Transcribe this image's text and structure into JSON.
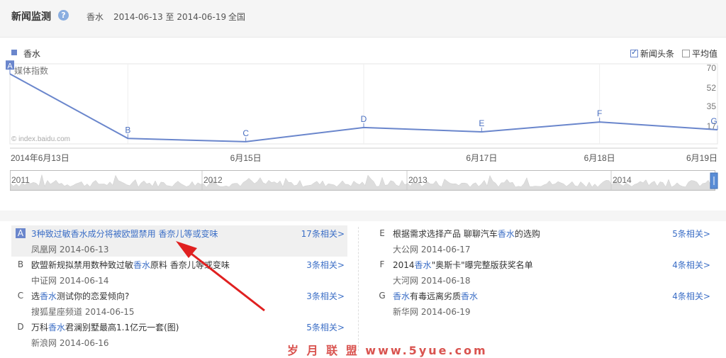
{
  "header": {
    "title": "新闻监测",
    "help_icon": "question-icon",
    "keyword": "香水",
    "date_range": "2014-06-13 至 2014-06-19",
    "region": "全国"
  },
  "legend": {
    "series_label": "香水",
    "color": "#6a86cc"
  },
  "options": {
    "news_headlines": {
      "label": "新闻头条",
      "checked": true
    },
    "average": {
      "label": "平均值",
      "checked": false
    }
  },
  "chart_data": {
    "type": "line",
    "ylabel": "媒体指数",
    "watermark": "© index.baidu.com",
    "y_ticks": [
      70,
      52,
      35,
      17
    ],
    "ylim": [
      0,
      70
    ],
    "x_tick_labels": [
      "2014年6月13日",
      "6月15日",
      "6月17日",
      "6月18日",
      "6月19日"
    ],
    "series": [
      {
        "name": "香水",
        "x": [
          "2014-06-13",
          "2014-06-14",
          "2014-06-15",
          "2014-06-16",
          "2014-06-17",
          "2014-06-18",
          "2014-06-19"
        ],
        "values": [
          64,
          5,
          2,
          15,
          11,
          20,
          13
        ],
        "markers": [
          "A",
          "B",
          "C",
          "D",
          "E",
          "F",
          "G"
        ]
      }
    ],
    "navigator_years": [
      "2011",
      "2012",
      "2013",
      "2014"
    ]
  },
  "news": {
    "left": [
      {
        "letter": "A",
        "title_parts": [
          [
            "3种致过敏香水成分将被欧盟禁用 香奈儿等或变味",
            false
          ]
        ],
        "source": "凤凰网 2014-06-13",
        "related": "17条相关>",
        "active": true
      },
      {
        "letter": "B",
        "title_parts": [
          [
            "欧盟新规拟禁用数种致过敏",
            false
          ],
          [
            "香水",
            true
          ],
          [
            "原料 香奈儿等或变味",
            false
          ]
        ],
        "source": "中证网 2014-06-14",
        "related": "3条相关>",
        "active": false
      },
      {
        "letter": "C",
        "title_parts": [
          [
            "选",
            false
          ],
          [
            "香水",
            true
          ],
          [
            "测试你的恋爱倾向?",
            false
          ]
        ],
        "source": "搜狐星座频道 2014-06-15",
        "related": "3条相关>",
        "active": false
      },
      {
        "letter": "D",
        "title_parts": [
          [
            "万科",
            false
          ],
          [
            "香水",
            true
          ],
          [
            "君澜别墅最高1.1亿元一套(图)",
            false
          ]
        ],
        "source": "新浪网 2014-06-16",
        "related": "5条相关>",
        "active": false
      }
    ],
    "right": [
      {
        "letter": "E",
        "title_parts": [
          [
            "根据需求选择产品 聊聊汽车",
            false
          ],
          [
            "香水",
            true
          ],
          [
            "的选购",
            false
          ]
        ],
        "source": "大公网 2014-06-17",
        "related": "5条相关>",
        "active": false
      },
      {
        "letter": "F",
        "title_parts": [
          [
            "2014",
            false
          ],
          [
            "香水",
            true
          ],
          [
            "\"奥斯卡\"曝完整版获奖名单",
            false
          ]
        ],
        "source": "大河网 2014-06-18",
        "related": "4条相关>",
        "active": false
      },
      {
        "letter": "G",
        "title_parts": [
          [
            "香水",
            true
          ],
          [
            "有毒远离劣质",
            false
          ],
          [
            "香水",
            true
          ]
        ],
        "source": "新华网 2014-06-19",
        "related": "4条相关>",
        "active": false
      }
    ]
  },
  "watermark_text": "岁 月 联 盟  www.5yue.com"
}
